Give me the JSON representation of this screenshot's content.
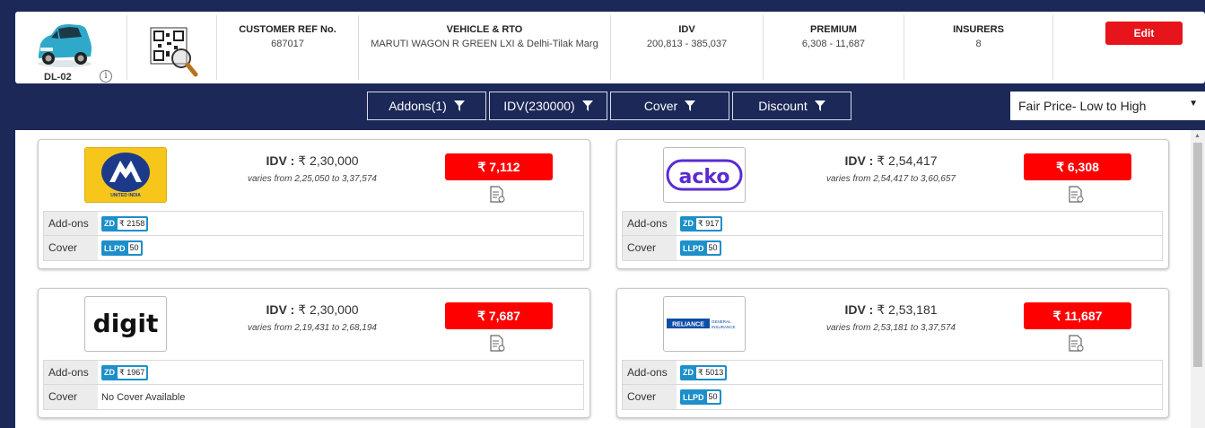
{
  "summary": {
    "rto": "DL-02",
    "customer_ref_label": "CUSTOMER REF No.",
    "customer_ref_value": "687017",
    "vehicle_label": "VEHICLE & RTO",
    "vehicle_value": "MARUTI WAGON R GREEN LXI & Delhi-Tilak Marg",
    "idv_label": "IDV",
    "idv_value": "200,813 - 385,037",
    "premium_label": "PREMIUM",
    "premium_value": "6,308 - 11,687",
    "insurers_label": "INSURERS",
    "insurers_value": "8",
    "edit_label": "Edit"
  },
  "filters": {
    "addons": "Addons(1)",
    "idv": "IDV(230000)",
    "cover": "Cover",
    "discount": "Discount",
    "sort": "Fair Price- Low to High"
  },
  "cards": [
    {
      "logo": "UNITED INDIA",
      "idv_label": "IDV :",
      "idv_value": "₹ 2,30,000",
      "varies": "varies from 2,25,050 to 3,37,574",
      "premium": "₹ 7,112",
      "addons_label": "Add-ons",
      "addon_tag": "ZD",
      "addon_value": "₹ 2158",
      "cover_label": "Cover",
      "cover_tag": "LLPD",
      "cover_value": "50"
    },
    {
      "logo": "acko",
      "idv_label": "IDV :",
      "idv_value": "₹ 2,54,417",
      "varies": "varies from 2,54,417 to 3,60,657",
      "premium": "₹ 6,308",
      "addons_label": "Add-ons",
      "addon_tag": "ZD",
      "addon_value": "₹ 917",
      "cover_label": "Cover",
      "cover_tag": "LLPD",
      "cover_value": "50"
    },
    {
      "logo": "digit",
      "idv_label": "IDV :",
      "idv_value": "₹ 2,30,000",
      "varies": "varies from 2,19,431 to 2,68,194",
      "premium": "₹ 7,687",
      "addons_label": "Add-ons",
      "addon_tag": "ZD",
      "addon_value": "₹ 1967",
      "cover_label": "Cover",
      "cover_text": "No Cover Available"
    },
    {
      "logo": "RELIANCE",
      "logo_sub": "GENERAL INSURANCE",
      "idv_label": "IDV :",
      "idv_value": "₹ 2,53,181",
      "varies": "varies from 2,53,181 to 3,37,574",
      "premium": "₹ 11,687",
      "addons_label": "Add-ons",
      "addon_tag": "ZD",
      "addon_value": "₹ 5013",
      "cover_label": "Cover",
      "cover_tag": "LLPD",
      "cover_value": "50"
    }
  ],
  "colors": {
    "navy": "#1b2858",
    "red": "#ff0000",
    "edit_red": "#e8141b",
    "tag_blue": "#1d8fc9"
  }
}
